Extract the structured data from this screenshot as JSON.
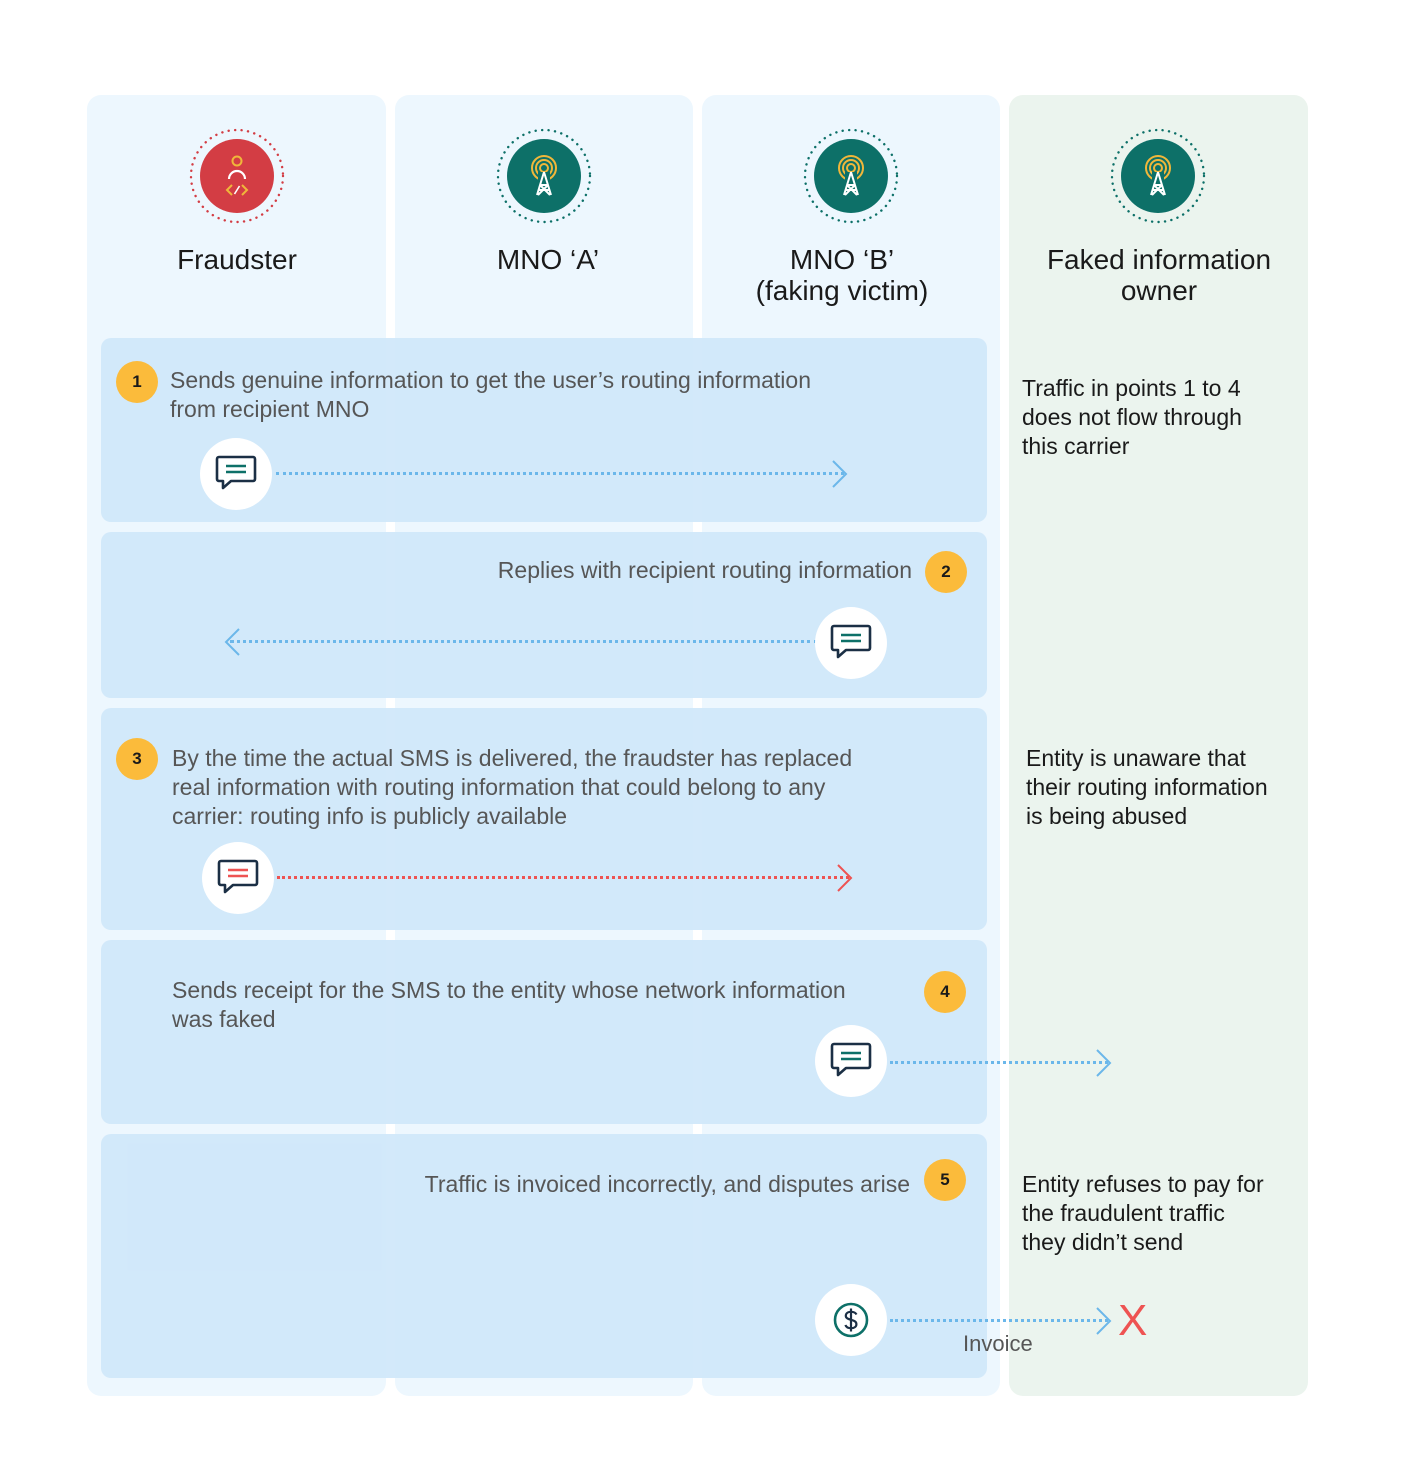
{
  "colors": {
    "column_blue": "#edf7fe",
    "column_green": "#ebf4ee",
    "row_blue": "#cfe7fa",
    "badge": "#fbbb3b",
    "fraudster_red": "#d33d44",
    "mno_teal": "#0d7068",
    "signal_yellow": "#f0b73a",
    "arrow_blue": "#6bb7ea",
    "arrow_red": "#ee5352",
    "x_red": "#ee5352"
  },
  "actors": [
    {
      "id": "fraudster",
      "label": "Fraudster",
      "icon": "fraudster-icon"
    },
    {
      "id": "mno-a",
      "label": "MNO ‘A’",
      "icon": "cell-tower-icon"
    },
    {
      "id": "mno-b",
      "label": "MNO ‘B’\n(faking victim)",
      "label_line1": "MNO ‘B’",
      "label_line2": "(faking victim)",
      "icon": "cell-tower-icon"
    },
    {
      "id": "owner",
      "label": "Faked information owner",
      "label_line1": "Faked information",
      "label_line2": "owner",
      "icon": "cell-tower-icon"
    }
  ],
  "steps": [
    {
      "number": "1",
      "text": "Sends genuine information to get the user’s routing information from recipient MNO",
      "line1": "Sends genuine information to get the user’s routing information",
      "line2": "from recipient MNO",
      "icon": "message-icon",
      "direction": "right",
      "arrow_color": "blue"
    },
    {
      "number": "2",
      "text": "Replies with recipient routing information",
      "icon": "message-icon",
      "direction": "left",
      "arrow_color": "blue"
    },
    {
      "number": "3",
      "text": "By the time the actual SMS is delivered, the fraudster has replaced real information with routing information that could belong to any carrier: routing info is publicly available",
      "line1": "By the time the actual SMS is delivered, the fraudster has replaced",
      "line2": "real information with routing information that could belong to any",
      "line3": "carrier: routing info is publicly available",
      "icon": "message-icon-red",
      "direction": "right",
      "arrow_color": "red"
    },
    {
      "number": "4",
      "text": "Sends receipt for the SMS to the entity whose network information was faked",
      "line1": "Sends receipt for the SMS to the entity whose network information",
      "line2": "was faked",
      "icon": "message-icon",
      "direction": "right",
      "arrow_color": "blue"
    },
    {
      "number": "5",
      "text": "Traffic is invoiced incorrectly, and disputes arise",
      "icon": "dollar-icon",
      "direction": "right",
      "arrow_color": "blue",
      "arrow_label": "Invoice",
      "end_mark": "X"
    }
  ],
  "notes": [
    {
      "text": "Traffic in points 1 to 4 does not flow through this carrier",
      "line1": "Traffic in points 1 to 4",
      "line2": "does not flow through",
      "line3": "this carrier"
    },
    {
      "text": "Entity is unaware that their routing information is being abused",
      "line1": "Entity is unaware that",
      "line2": "their routing information",
      "line3": "is being abused"
    },
    {
      "text": "Entity refuses to pay for the fraudulent traffic they didn’t send",
      "line1": "Entity refuses to pay for",
      "line2": "the fraudulent traffic",
      "line3": "they didn’t send"
    }
  ]
}
